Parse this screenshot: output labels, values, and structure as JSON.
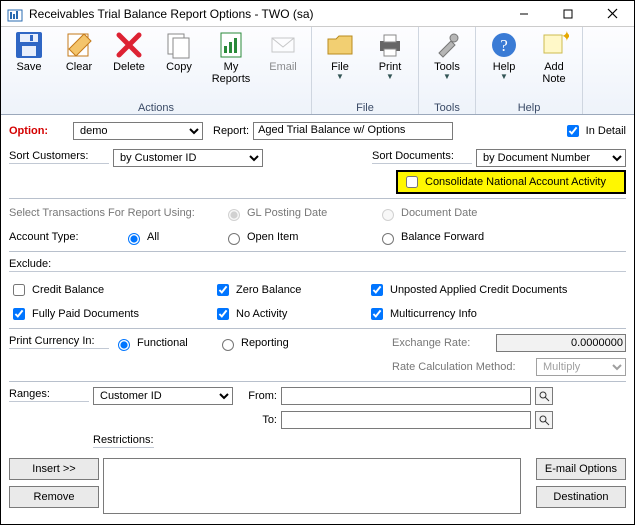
{
  "window": {
    "title": "Receivables Trial Balance Report Options  -  TWO (sa)"
  },
  "ribbon": {
    "save": "Save",
    "clear": "Clear",
    "delete": "Delete",
    "copy": "Copy",
    "myreports": "My Reports",
    "email": "Email",
    "file": "File",
    "print": "Print",
    "tools": "Tools",
    "help": "Help",
    "addnote": "Add Note",
    "group_actions": "Actions",
    "group_file": "File",
    "group_tools": "Tools",
    "group_help": "Help"
  },
  "option": {
    "label": "Option:",
    "value": "demo",
    "report_label": "Report:",
    "report_value": "Aged Trial Balance w/ Options",
    "indetail": "In Detail"
  },
  "sort": {
    "customers_label": "Sort Customers:",
    "customers_value": "by Customer ID",
    "documents_label": "Sort Documents:",
    "documents_value": "by Document Number",
    "consolidate": "Consolidate National Account Activity"
  },
  "select": {
    "line": "Select Transactions For Report Using:",
    "gl_posting": "GL Posting Date",
    "doc_date": "Document Date",
    "acct_label": "Account Type:",
    "all": "All",
    "openitem": "Open Item",
    "balfwd": "Balance Forward"
  },
  "exclude": {
    "label": "Exclude:",
    "credit_balance": "Credit Balance",
    "zero_balance": "Zero Balance",
    "unposted": "Unposted Applied Credit Documents",
    "fully_paid": "Fully Paid Documents",
    "no_activity": "No Activity",
    "multicurrency": "Multicurrency Info"
  },
  "printcur": {
    "label": "Print Currency In:",
    "functional": "Functional",
    "reporting": "Reporting",
    "exrate_label": "Exchange Rate:",
    "exrate_value": "0.0000000",
    "ratemethod_label": "Rate Calculation Method:",
    "ratemethod_value": "Multiply"
  },
  "ranges": {
    "label": "Ranges:",
    "value": "Customer ID",
    "from": "From:",
    "to": "To:",
    "restrictions": "Restrictions:",
    "insert": "Insert >>",
    "remove": "Remove",
    "emailopts": "E-mail Options",
    "destination": "Destination"
  }
}
